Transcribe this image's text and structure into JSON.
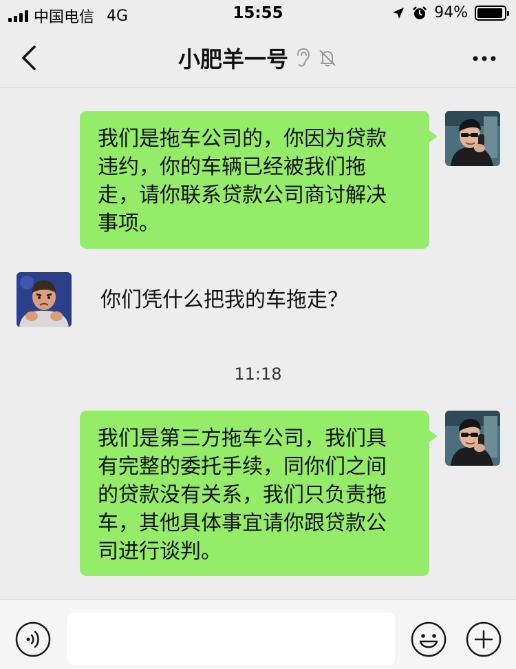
{
  "status_bar": {
    "carrier": "中国电信",
    "network": "4G",
    "time": "15:55",
    "battery_text": "94%",
    "battery_level": 0.94
  },
  "header": {
    "title": "小肥羊一号",
    "back_icon": "chevron-left-icon",
    "ear_icon": "ear-icon",
    "mute_icon": "bell-slash-icon",
    "more_icon": "more-icon"
  },
  "messages": [
    {
      "side": "out",
      "text_lines": [
        "我们是拖车公司的，你因为贷款",
        "违约，你的车辆已经被我们拖",
        "走，请你联系贷款公司商讨解决",
        "事项。"
      ]
    },
    {
      "side": "in",
      "text_lines": [
        "你们凭什么把我的车拖走？"
      ]
    },
    {
      "side": "time",
      "text": "11:18"
    },
    {
      "side": "out",
      "text_lines": [
        "我们是第三方拖车公司，我们具",
        "有完整的委托手续，同你们之间",
        "的贷款没有关系，我们只负责拖",
        "车，其他具体事宜请你跟贷款公",
        "司进行谈判。"
      ]
    }
  ],
  "input_bar": {
    "placeholder": "",
    "voice_icon": "voice-icon",
    "emoji_icon": "emoji-icon",
    "plus_icon": "plus-icon"
  },
  "colors": {
    "background": "#ededed",
    "outgoing_bubble": "#95ec69",
    "input_bar": "#f5f5f5"
  }
}
